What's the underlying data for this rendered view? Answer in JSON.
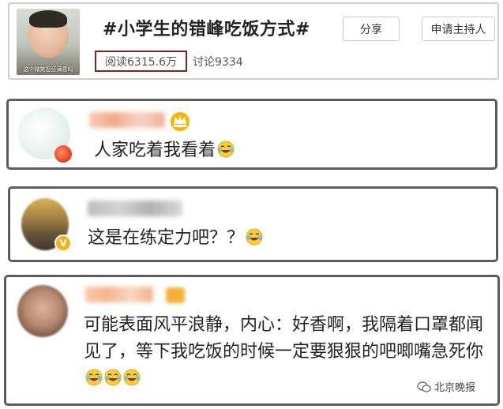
{
  "topic": {
    "thumbnail_caption": "这个微笑您还满意吗",
    "title": "#小学生的错峰吃饭方式#",
    "share_label": "分享",
    "host_label": "申请主持人",
    "read_count": "阅读6315.6万",
    "discuss_count": "讨论9334"
  },
  "comments": [
    {
      "text": "人家吃着我看着",
      "emoji": "laugh-cry-icon",
      "emoji_count": 1
    },
    {
      "text": "这是在练定力吧？？",
      "emoji": "laugh-cry-icon",
      "emoji_count": 1
    },
    {
      "text": "可能表面风平浪静，内心：好香啊，我隔着口罩都闻见了，等下我吃饭的时候一定要狠狠的吧唧嘴急死你",
      "emoji": "laugh-cry-icon",
      "emoji_count": 3
    }
  ],
  "watermark": {
    "label": "北京晚报"
  },
  "colors": {
    "read_box_border": "#8a1f24",
    "card_border": "#5c5c5c",
    "badge_gold": "#f3b21a"
  }
}
